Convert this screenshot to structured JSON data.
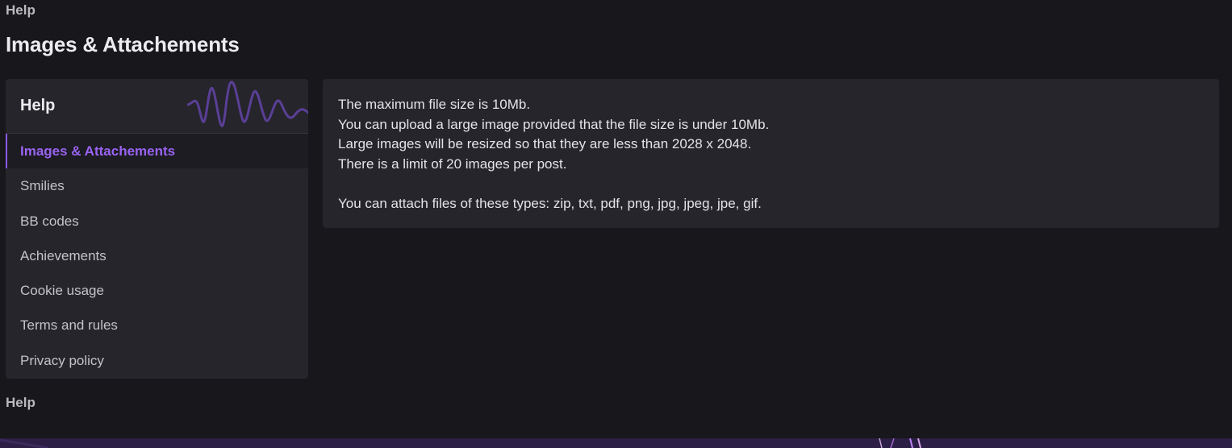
{
  "breadcrumb": {
    "top": "Help",
    "bottom": "Help"
  },
  "page": {
    "title": "Images & Attachements"
  },
  "sidebar": {
    "heading": "Help",
    "items": [
      {
        "label": "Images & Attachements",
        "active": true
      },
      {
        "label": "Smilies",
        "active": false
      },
      {
        "label": "BB codes",
        "active": false
      },
      {
        "label": "Achievements",
        "active": false
      },
      {
        "label": "Cookie usage",
        "active": false
      },
      {
        "label": "Terms and rules",
        "active": false
      },
      {
        "label": "Privacy policy",
        "active": false
      }
    ]
  },
  "content": {
    "lines": [
      "The maximum file size is 10Mb.",
      "You can upload a large image provided that the file size is under 10Mb.",
      "Large images will be resized so that they are less than 2028 x 2048.",
      "There is a limit of 20 images per post."
    ],
    "attach_line": "You can attach files of these types: zip, txt, pdf, png, jpg, jpeg, jpe, gif."
  },
  "colors": {
    "background": "#17171c",
    "panel": "#25252b",
    "accent": "#8b5cf6",
    "footer": "#2c1f45"
  }
}
